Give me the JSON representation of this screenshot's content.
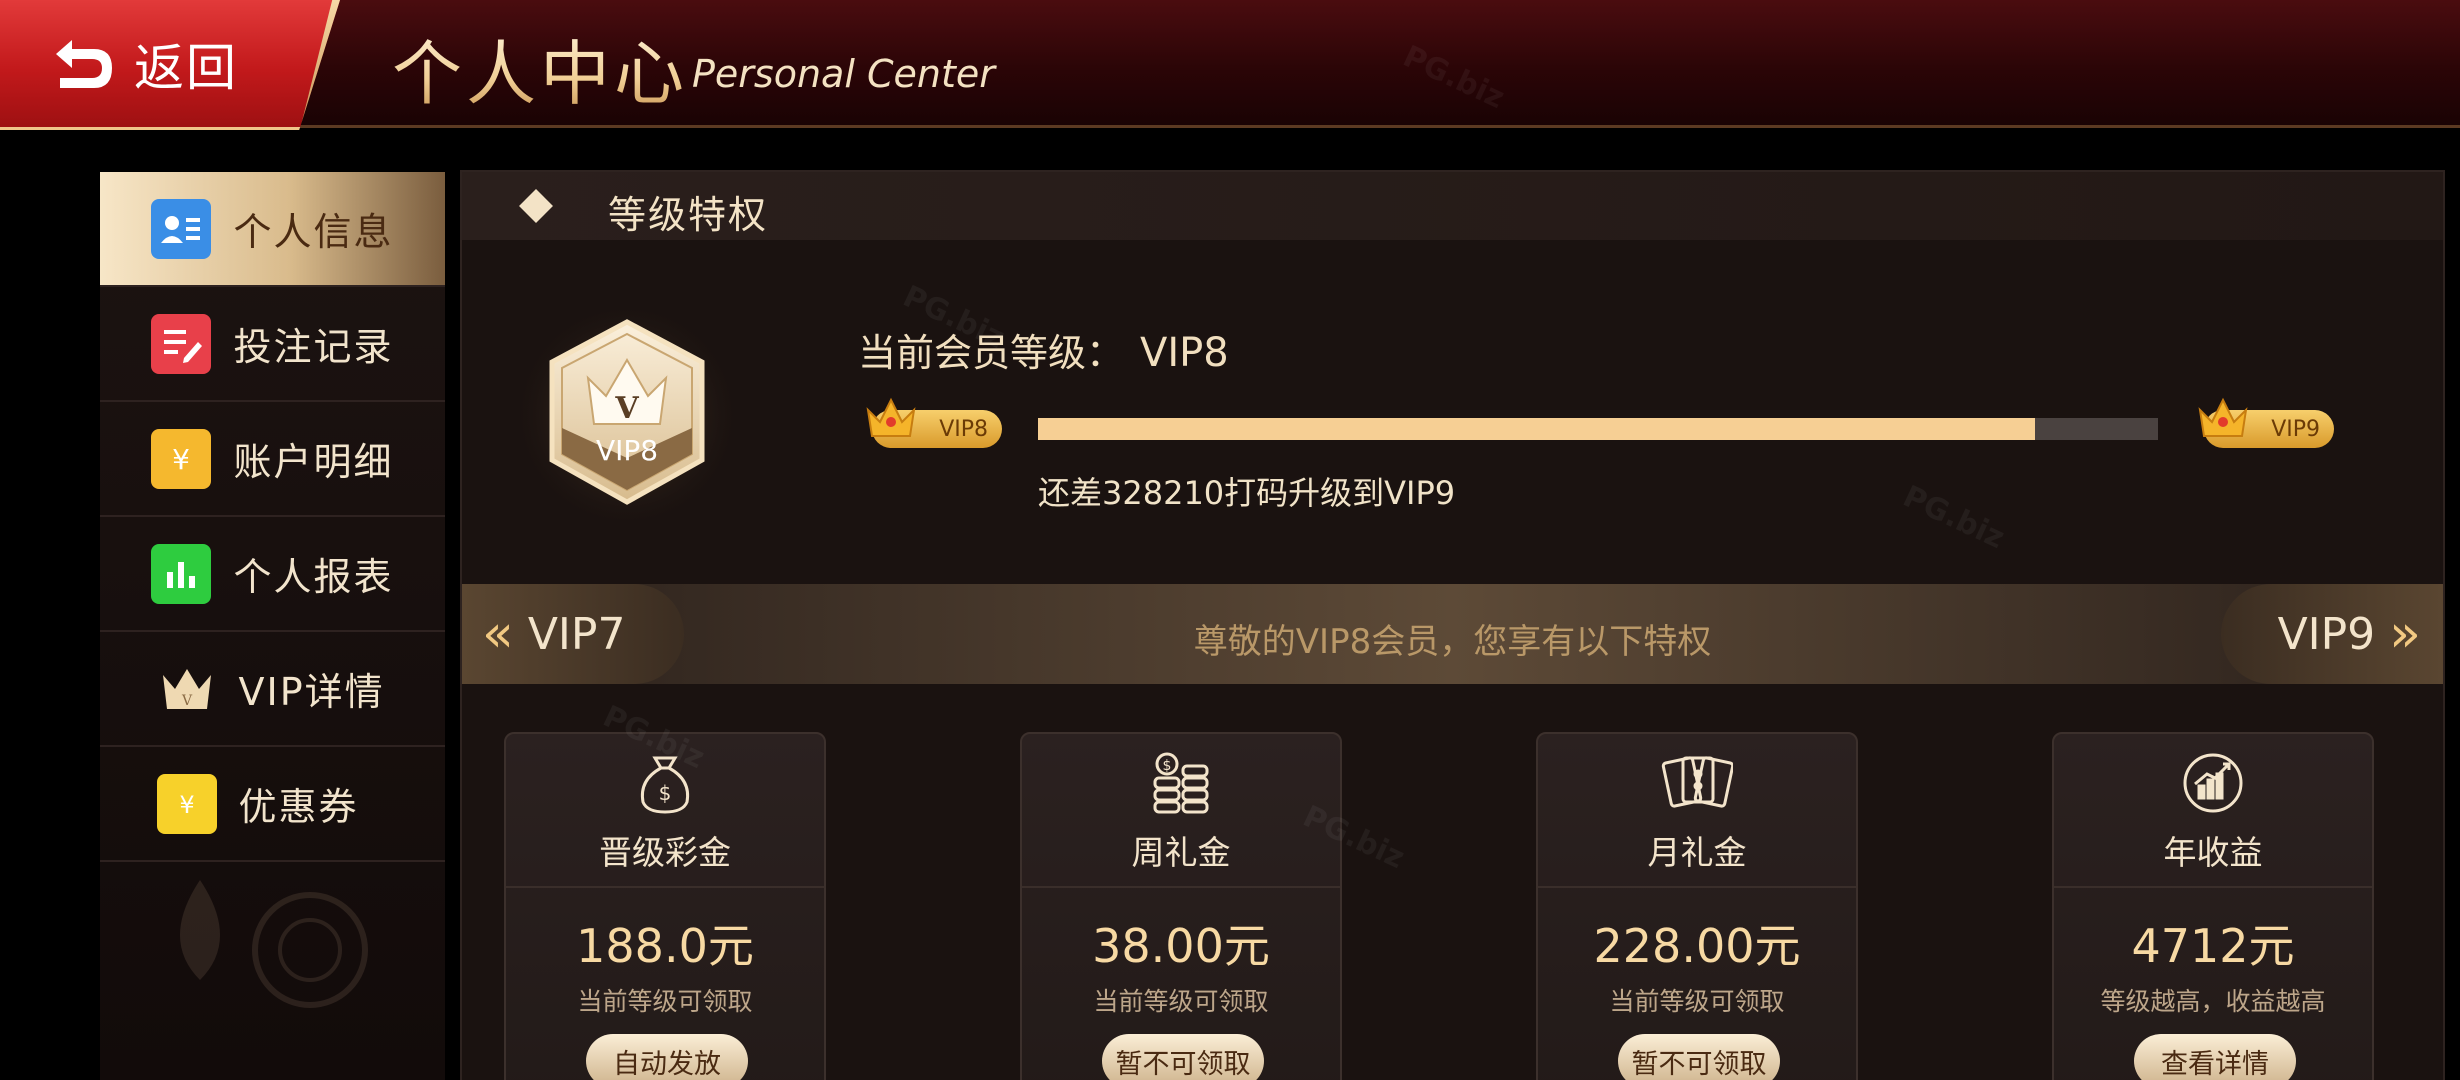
{
  "header": {
    "back_label": "返回",
    "title_cn": "个人中心",
    "title_en": "Personal Center"
  },
  "sidebar": {
    "items": [
      {
        "label": "个人信息",
        "icon": "user-card-icon",
        "active": true
      },
      {
        "label": "投注记录",
        "icon": "bet-record-icon",
        "active": false
      },
      {
        "label": "账户明细",
        "icon": "wallet-icon",
        "active": false
      },
      {
        "label": "个人报表",
        "icon": "bar-chart-icon",
        "active": false
      },
      {
        "label": "VIP详情",
        "icon": "crown-icon",
        "active": false
      },
      {
        "label": "优惠券",
        "icon": "coupon-icon",
        "active": false
      }
    ]
  },
  "main": {
    "section_title": "等级特权",
    "badge_label": "VIP8",
    "badge_letter": "V",
    "current_level_label": "当前会员等级：",
    "current_level": "VIP8",
    "progress": {
      "from_level": "VIP8",
      "to_level": "VIP9",
      "fraction": 0.89,
      "note": "还差328210打码升级到VIP9"
    },
    "strip": {
      "prev_label": "VIP7",
      "next_label": "VIP9",
      "text": "尊敬的VIP8会员，您享有以下特权"
    },
    "cards": [
      {
        "title": "晋级彩金",
        "value": "188.0元",
        "sub": "当前等级可领取",
        "button": "自动发放",
        "icon": "money-bag-icon"
      },
      {
        "title": "周礼金",
        "value": "38.00元",
        "sub": "当前等级可领取",
        "button": "暂不可领取",
        "icon": "coin-stack-icon"
      },
      {
        "title": "月礼金",
        "value": "228.00元",
        "sub": "当前等级可领取",
        "button": "暂不可领取",
        "icon": "cash-notes-icon"
      },
      {
        "title": "年收益",
        "value": "4712元",
        "sub": "等级越高，收益越高",
        "button": "查看详情",
        "icon": "growth-chart-icon"
      }
    ]
  },
  "colors": {
    "accent_gold": "#f6cf94",
    "back_red": "#c2191b",
    "panel_bg": "#1a1210"
  },
  "watermark": "PG.biz"
}
